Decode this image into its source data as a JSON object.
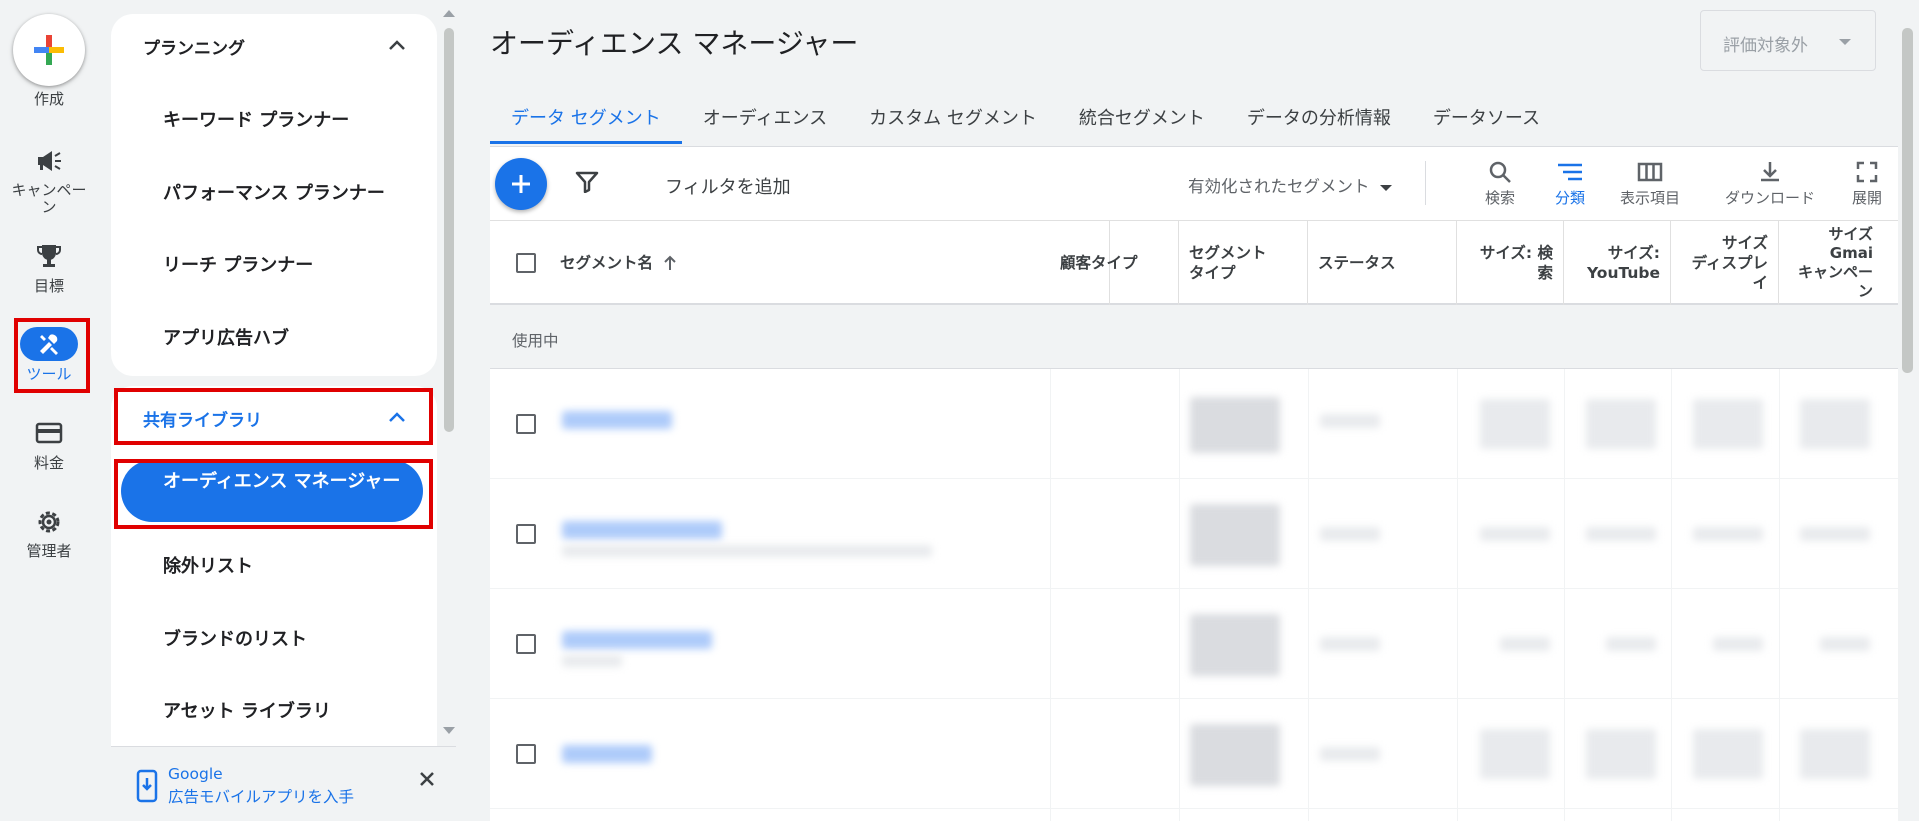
{
  "rail": {
    "create_label": "作成",
    "campaigns_label": "キャンペー\nン",
    "goals_label": "目標",
    "tools_label": "ツール",
    "billing_label": "料金",
    "admin_label": "管理者"
  },
  "nav": {
    "planning_header": "プランニング",
    "planning_items": [
      "キーワード プランナー",
      "パフォーマンス プランナー",
      "リーチ プランナー",
      "アプリ広告ハブ"
    ],
    "shared_library_header": "共有ライブラリ",
    "active_item": "オーディエンス マネージャー",
    "library_items": [
      "除外リスト",
      "ブランドのリスト",
      "アセット ライブラリ"
    ]
  },
  "promo": {
    "line1": "Google",
    "line2": "広告モバイルアプリを入手"
  },
  "page": {
    "title": "オーディエンス マネージャー",
    "eval_select": "評価対象外"
  },
  "tabs": [
    {
      "label": "データ セグメント",
      "active": true
    },
    {
      "label": "オーディエンス"
    },
    {
      "label": "カスタム セグメント"
    },
    {
      "label": "統合セグメント"
    },
    {
      "label": "データの分析情報"
    },
    {
      "label": "データソース"
    }
  ],
  "toolbar": {
    "filter_label": "フィルタを追加",
    "segment_dropdown": "有効化されたセグメント",
    "search": "検索",
    "segment_view": "分類",
    "columns": "表示項目",
    "download": "ダウンロード",
    "expand": "展開"
  },
  "table": {
    "headers": {
      "name": "セグメント名",
      "customer_type": "顧客タイプ",
      "segment_type": "セグメント\nタイプ",
      "status": "ステータス",
      "size_search": "サイズ: 検索",
      "size_youtube": "サイズ:\nYouTube",
      "size_display": "サイズ\nディスプレイ",
      "size_gmail": "サイズ\nGmai\nキャンペーン"
    },
    "group_label": "使用中"
  },
  "colors": {
    "accent": "#1a73e8",
    "highlight": "#e00000"
  }
}
